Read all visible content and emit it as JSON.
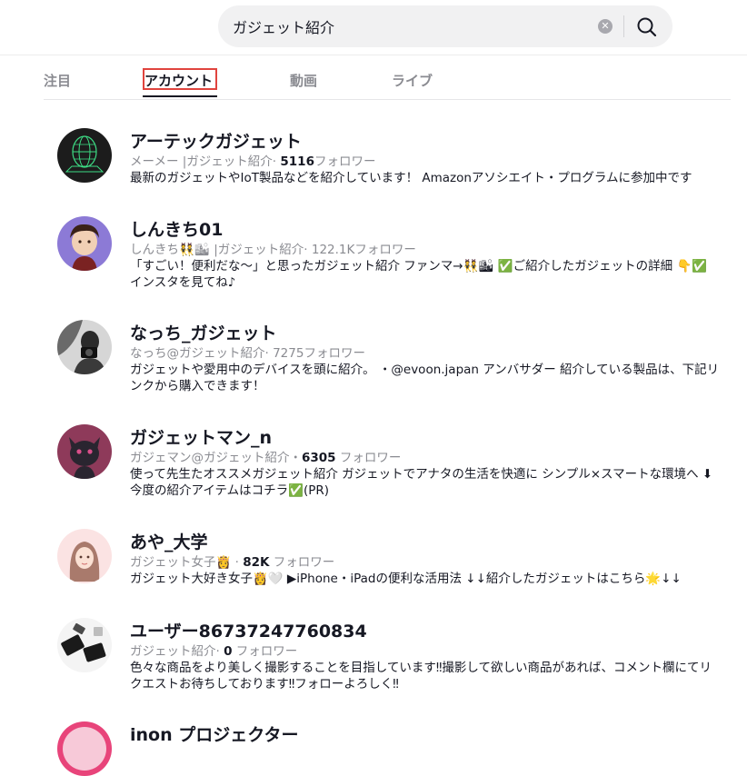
{
  "search": {
    "query": "ガジェット紹介",
    "clear_icon": "clear-circle-icon",
    "search_icon": "search-icon"
  },
  "tabs": [
    {
      "label": "注目"
    },
    {
      "label": "アカウント"
    },
    {
      "label": "動画"
    },
    {
      "label": "ライブ"
    }
  ],
  "active_tab": "アカウント",
  "results": [
    {
      "name": "アーテックガジェット",
      "meta_prefix": "メーメー |ガジェット紹介· ",
      "followers": "5116",
      "followers_suffix": "フォロワー",
      "description": "最新のガジェットやIoT製品などを紹介しています！ Amazonアソシエイト・プログラムに参加中です"
    },
    {
      "name": "しんきち01",
      "meta_prefix": "しんきち👯🏙 |ガジェット紹介· ",
      "followers": "122.1K",
      "followers_suffix": "フォロワー",
      "description": "「すごい！便利だな〜」と思ったガジェット紹介 ファンマ→👯🏙 ✅ご紹介したガジェットの詳細 👇✅ インスタを見てね♪"
    },
    {
      "name": "なっち_ガジェット",
      "meta_prefix": "なっち@ガジェット紹介· ",
      "followers": "7275",
      "followers_suffix": "フォロワー",
      "description": "ガジェットや愛用中のデバイスを頭に紹介。 ・@evoon.japan アンバサダー 紹介している製品は、下記リンクから購入できます！"
    },
    {
      "name": "ガジェットマン_n",
      "meta_prefix": "ガジェマン@ガジェット紹介・",
      "followers": "6305",
      "followers_suffix": " フォロワー",
      "description": "使って先生たオススメガジェット紹介 ガジェットでアナタの生活を快適に シンプル×スマートな環境へ ⬇今度の紹介アイテムはコチラ✅(PR)"
    },
    {
      "name": "あや_大学",
      "meta_prefix": "ガジェット女子👸 · ",
      "followers": "82K",
      "followers_suffix": " フォロワー",
      "description": "ガジェット大好き女子👸🤍 ▶iPhone・iPadの便利な活用法 ↓↓紹介したガジェットはこちら🌟↓↓"
    },
    {
      "name": "ユーザー86737247760834",
      "meta_prefix": "ガジェット紹介· ",
      "followers": "0",
      "followers_suffix": " フォロワー",
      "description": "色々な商品をより美しく撮影することを目指しています‼撮影して欲しい商品があれば、コメント欄にてリクエストお待ちしております‼フォローよろしく‼"
    },
    {
      "name": "inon プロジェクター",
      "meta_prefix": "",
      "followers": "",
      "followers_suffix": "",
      "description": ""
    }
  ],
  "colors": {
    "accent_outline": "#e0443e",
    "text_primary": "#161823",
    "text_secondary": "#8a8b91"
  }
}
